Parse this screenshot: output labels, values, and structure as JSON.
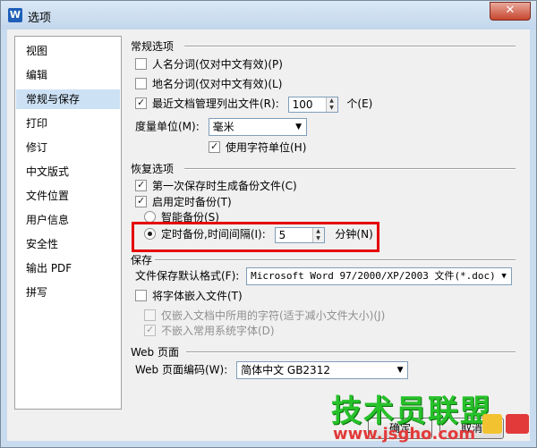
{
  "window": {
    "title": "选项",
    "app_icon": "W",
    "close_glyph": "✕"
  },
  "sidebar": {
    "items": [
      {
        "label": "视图"
      },
      {
        "label": "编辑"
      },
      {
        "label": "常规与保存",
        "selected": true
      },
      {
        "label": "打印"
      },
      {
        "label": "修订"
      },
      {
        "label": "中文版式"
      },
      {
        "label": "文件位置"
      },
      {
        "label": "用户信息"
      },
      {
        "label": "安全性"
      },
      {
        "label": "输出 PDF"
      },
      {
        "label": "拼写"
      }
    ]
  },
  "general": {
    "title": "常规选项",
    "name_segmentation": {
      "label": "人名分词(仅对中文有效)(P)",
      "checked": false
    },
    "place_segmentation": {
      "label": "地名分词(仅对中文有效)(L)",
      "checked": false
    },
    "recent_files": {
      "label": "最近文档管理列出文件(R):",
      "checked": true,
      "value": "100",
      "unit": "个(E)"
    },
    "measure_unit": {
      "label": "度量单位(M):",
      "value": "毫米"
    },
    "use_char_unit": {
      "label": "使用字符单位(H)",
      "checked": true
    }
  },
  "recovery": {
    "title": "恢复选项",
    "first_save_backup": {
      "label": "第一次保存时生成备份文件(C)",
      "checked": true
    },
    "timed_backup": {
      "label": "启用定时备份(T)",
      "checked": true
    },
    "smart_backup": {
      "label": "智能备份(S)",
      "selected": false
    },
    "interval_backup": {
      "label": "定时备份,时间间隔(I):",
      "selected": true,
      "value": "5",
      "unit": "分钟(N)"
    }
  },
  "save": {
    "title": "保存",
    "default_format": {
      "label": "文件保存默认格式(F):",
      "value": "Microsoft Word 97/2000/XP/2003 文件(*.doc)"
    },
    "embed_fonts": {
      "label": "将字体嵌入文件(T)",
      "checked": false
    },
    "embed_used_chars": {
      "label": "仅嵌入文档中所用的字符(适于减小文件大小)(J)",
      "checked": false
    },
    "no_system_fonts": {
      "label": "不嵌入常用系统字体(D)",
      "checked": true
    }
  },
  "web": {
    "title": "Web 页面",
    "encoding": {
      "label": "Web 页面编码(W):",
      "value": "简体中文 GB2312"
    }
  },
  "buttons": {
    "ok": "确定",
    "cancel": "取消"
  },
  "watermark": {
    "text": "技术员联盟",
    "url": "www.jsgho.com"
  }
}
